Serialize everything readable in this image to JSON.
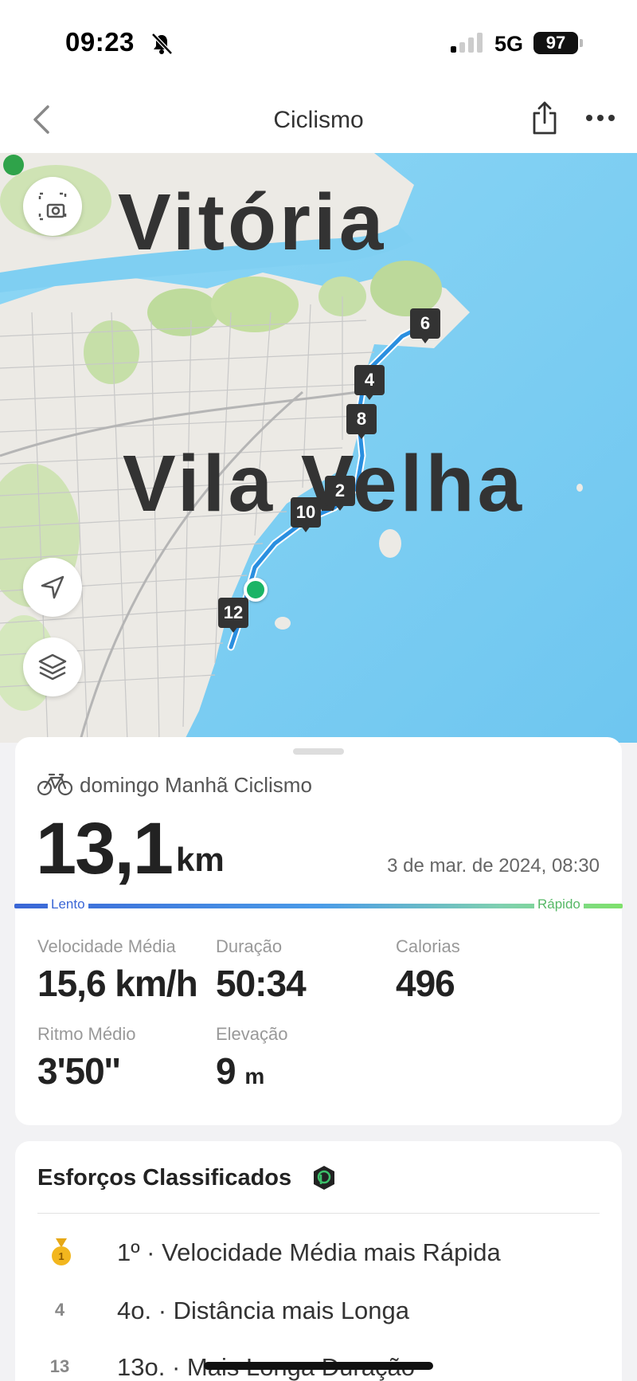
{
  "status_bar": {
    "time": "09:23",
    "network": "5G",
    "battery": "97"
  },
  "nav": {
    "title": "Ciclismo"
  },
  "map": {
    "city_labels": [
      "Vitória",
      "Vila Velha"
    ],
    "route_color": "#2a8fe0",
    "water_color": "#7fcff2",
    "km_markers": [
      "6",
      "4",
      "8",
      "2",
      "10",
      "12"
    ]
  },
  "summary": {
    "activity_label": "domingo Manhã Ciclismo",
    "distance_value": "13,1",
    "distance_unit": "km",
    "date": "3 de mar. de 2024, 08:30",
    "speed_scale": {
      "slow_label": "Lento",
      "fast_label": "Rápido"
    },
    "stats": [
      {
        "label": "Velocidade Média",
        "value": "15,6 km/h",
        "unit": ""
      },
      {
        "label": "Duração",
        "value": "50:34",
        "unit": ""
      },
      {
        "label": "Calorias",
        "value": "496",
        "unit": ""
      },
      {
        "label": "Ritmo Médio",
        "value": "3'50''",
        "unit": ""
      },
      {
        "label": "Elevação",
        "value": "9",
        "unit": "m"
      }
    ]
  },
  "efforts": {
    "title": "Esforços Classificados",
    "items": [
      {
        "rank": "1",
        "text": "1º · Velocidade Média mais Rápida"
      },
      {
        "rank": "4",
        "text": "4o. · Distância mais Longa"
      },
      {
        "rank": "13",
        "text": "13o. · Mais Longa Duração"
      }
    ]
  },
  "colors": {
    "accent_green": "#1ab466",
    "slow_blue": "#3a66d6",
    "fast_green": "#56b866",
    "medal_gold": "#f2b61e"
  }
}
